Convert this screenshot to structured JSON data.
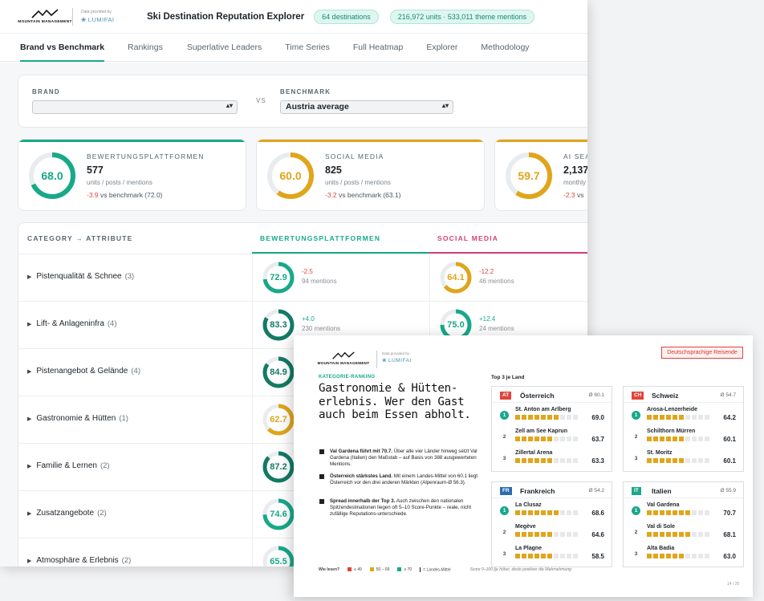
{
  "header": {
    "logo_text": "MOUNTAIN MANAGEMENT",
    "provided_by": "Data provided by",
    "provider": "LUMIFAI",
    "title": "Ski Destination Reputation Explorer",
    "pill_destinations": "64 destinations",
    "pill_units": "216,972 units · 533,011 theme mentions"
  },
  "tabs": [
    {
      "label": "Brand vs Benchmark",
      "active": true
    },
    {
      "label": "Rankings"
    },
    {
      "label": "Superlative Leaders"
    },
    {
      "label": "Time Series"
    },
    {
      "label": "Full Heatmap"
    },
    {
      "label": "Explorer"
    },
    {
      "label": "Methodology"
    }
  ],
  "selector": {
    "brand_label": "BRAND",
    "brand_value": "",
    "vs": "VS",
    "benchmark_label": "BENCHMARK",
    "benchmark_value": "Austria average"
  },
  "kpis": [
    {
      "label": "BEWERTUNGSPLATTFORMEN",
      "score": "68.0",
      "fraction": 0.68,
      "color": "#18a88a",
      "count": "577",
      "sub": "units / posts / mentions",
      "delta": "-3.9",
      "delta_text": "vs benchmark (72.0)"
    },
    {
      "label": "SOCIAL MEDIA",
      "score": "60.0",
      "fraction": 0.6,
      "color": "#e0a51b",
      "count": "825",
      "sub": "units / posts / mentions",
      "delta": "-3.2",
      "delta_text": "vs benchmark (63.1)"
    },
    {
      "label": "AI SEA",
      "score": "59.7",
      "fraction": 0.597,
      "color": "#e0a51b",
      "count": "2,137",
      "sub": "monthly",
      "delta": "-2.3",
      "delta_text": "vs"
    }
  ],
  "table": {
    "col_category": "CATEGORY → ATTRIBUTE",
    "col_platforms": "BEWERTUNGSPLATTFORMEN",
    "col_social": "SOCIAL MEDIA",
    "rows": [
      {
        "name": "Pistenqualität & Schnee",
        "count": "(3)",
        "p": {
          "score": "72.9",
          "fraction": 0.729,
          "color": "#18a88a",
          "delta": "-2.5",
          "mentions": "94 mentions"
        },
        "s": {
          "score": "64.1",
          "fraction": 0.641,
          "color": "#e0a51b",
          "delta": "-12.2",
          "mentions": "46 mentions"
        }
      },
      {
        "name": "Lift- & Anlageninfra",
        "count": "(4)",
        "p": {
          "score": "83.3",
          "fraction": 0.833,
          "color": "#137a66",
          "delta": "+4.0",
          "mentions": "230 mentions"
        },
        "s": {
          "score": "75.0",
          "fraction": 0.75,
          "color": "#18a88a",
          "delta": "+12.4",
          "mentions": "24 mentions"
        }
      },
      {
        "name": "Pistenangebot & Gelände",
        "count": "(4)",
        "p": {
          "score": "84.9",
          "fraction": 0.849,
          "color": "#137a66"
        }
      },
      {
        "name": "Gastronomie & Hütten",
        "count": "(1)",
        "p": {
          "score": "62.7",
          "fraction": 0.627,
          "color": "#e0a51b"
        }
      },
      {
        "name": "Familie & Lernen",
        "count": "(2)",
        "p": {
          "score": "87.2",
          "fraction": 0.872,
          "color": "#137a66"
        }
      },
      {
        "name": "Zusatzangebote",
        "count": "(2)",
        "p": {
          "score": "74.6",
          "fraction": 0.746,
          "color": "#18a88a"
        }
      },
      {
        "name": "Atmosphäre & Erlebnis",
        "count": "(2)",
        "p": {
          "score": "65.5",
          "fraction": 0.655,
          "color": "#18a88a"
        }
      }
    ]
  },
  "report": {
    "logo_text": "MOUNTAIN MANAGEMENT",
    "provided_by": "Data provided by",
    "provider": "LUMIFAI",
    "badge": "Deutschsprachige Reisende",
    "tag": "KATEGORIE-RANKING",
    "title": "Gastronomie & Hütten-erlebnis. Wer den Gast auch beim Essen abholt.",
    "bullets": [
      {
        "bold": "Val Gardena führt mit 70.7.",
        "text": " Über alle vier Länder hinweg setzt Val Gardena (Italien) den Maßstab – auf Basis von 388 ausgewerteten Mentions."
      },
      {
        "bold": "Österreich stärkstes Land.",
        "text": " Mit einem Landes-Mittel von 60.1 liegt Österreich vor den drei anderen Märkten (Alpenraum-Ø 56.3)."
      },
      {
        "bold": "Spread innerhalb der Top 3.",
        "text": " Auch zwischen den nationalen Spitzendestinationen liegen oft 5–10 Score-Punkte – reale, nicht zufällige Reputations-unterschiede."
      }
    ],
    "top3_label": "Top 3 je Land",
    "countries": [
      {
        "code": "AT",
        "name": "Österreich",
        "avg": "Ø 60.1",
        "entries": [
          {
            "rank": "1",
            "name": "St. Anton am Arlberg",
            "score": "69.0",
            "value": 69.0
          },
          {
            "rank": "2",
            "name": "Zell am See Kaprun",
            "score": "63.7",
            "value": 63.7
          },
          {
            "rank": "3",
            "name": "Zillertal Arena",
            "score": "63.3",
            "value": 63.3
          }
        ]
      },
      {
        "code": "CH",
        "name": "Schweiz",
        "avg": "Ø 54.7",
        "entries": [
          {
            "rank": "1",
            "name": "Arosa-Lenzerheide",
            "score": "64.2",
            "value": 64.2
          },
          {
            "rank": "2",
            "name": "Schilthorn Mürren",
            "score": "60.1",
            "value": 60.1
          },
          {
            "rank": "3",
            "name": "St. Moritz",
            "score": "60.1",
            "value": 60.1
          }
        ]
      },
      {
        "code": "FR",
        "name": "Frankreich",
        "avg": "Ø 54.2",
        "entries": [
          {
            "rank": "1",
            "name": "La Clusaz",
            "score": "68.6",
            "value": 68.6
          },
          {
            "rank": "2",
            "name": "Megève",
            "score": "64.6",
            "value": 64.6
          },
          {
            "rank": "3",
            "name": "La Plagne",
            "score": "58.5",
            "value": 58.5
          }
        ]
      },
      {
        "code": "IT",
        "name": "Italien",
        "avg": "Ø 55.9",
        "entries": [
          {
            "rank": "1",
            "name": "Val Gardena",
            "score": "70.7",
            "value": 70.7
          },
          {
            "rank": "2",
            "name": "Val di Sole",
            "score": "68.1",
            "value": 68.1
          },
          {
            "rank": "3",
            "name": "Alta Badia",
            "score": "63.0",
            "value": 63.0
          }
        ]
      }
    ],
    "legend": {
      "question": "Wie lesen?",
      "low": "≤ 49",
      "mid": "50 – 69",
      "high": "≥ 70",
      "mean": "= Landes-Mittel",
      "note": "Score 0–100 (je höher, desto positiver die Wahrnehmung"
    },
    "page": "14 / 25",
    "colors": {
      "at": "#e0453a",
      "ch": "#e0453a",
      "fr": "#2b6cb0",
      "it": "#18a88a",
      "bar": "#e0a51b",
      "low": "#e0453a",
      "mid": "#e0a51b",
      "high": "#18a88a"
    }
  }
}
